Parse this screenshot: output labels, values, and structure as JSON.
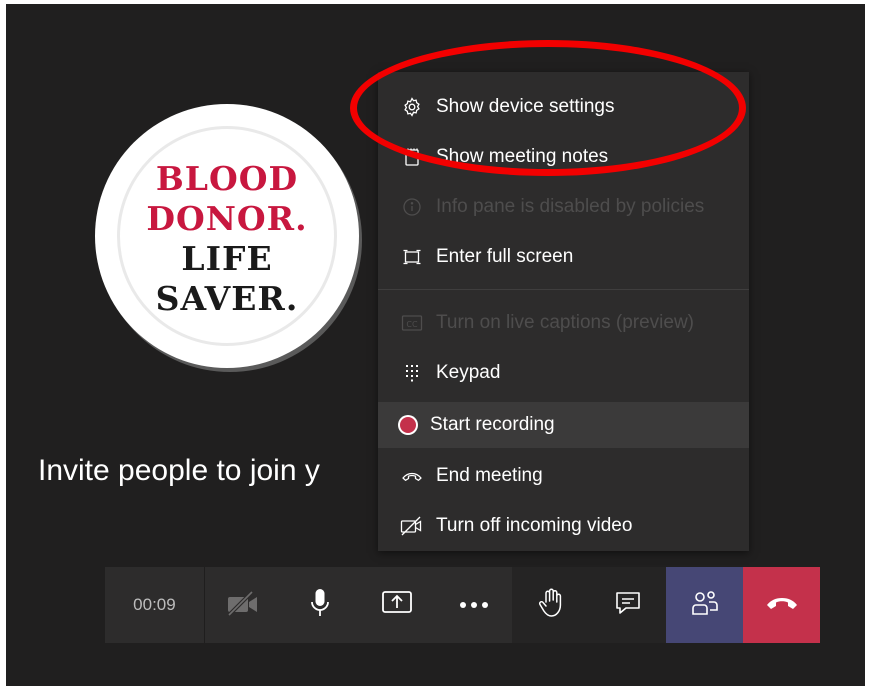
{
  "avatar": {
    "line1": "BLOOD",
    "line2": "DONOR.",
    "line3": "LIFE",
    "line4": "SAVER."
  },
  "invite_text": "Invite people to join y",
  "menu": {
    "items": [
      {
        "label": "Show device settings",
        "icon": "gear-icon",
        "enabled": true
      },
      {
        "label": "Show meeting notes",
        "icon": "notes-icon",
        "enabled": true
      },
      {
        "label": "Info pane is disabled by policies",
        "icon": "info-icon",
        "enabled": false
      },
      {
        "label": "Enter full screen",
        "icon": "fullscreen-icon",
        "enabled": true
      },
      {
        "label": "Turn on live captions (preview)",
        "icon": "captions-icon",
        "enabled": false
      },
      {
        "label": "Keypad",
        "icon": "keypad-icon",
        "enabled": true
      },
      {
        "label": "Start recording",
        "icon": "record-icon",
        "enabled": true
      },
      {
        "label": "End meeting",
        "icon": "end-meeting-icon",
        "enabled": true
      },
      {
        "label": "Turn off incoming video",
        "icon": "video-off-icon",
        "enabled": true
      }
    ]
  },
  "toolbar": {
    "timer": "00:09",
    "buttons": [
      "camera-off-icon",
      "microphone-icon",
      "share-screen-icon",
      "more-options-icon",
      "raise-hand-icon",
      "chat-icon",
      "participants-icon",
      "hang-up-icon"
    ]
  },
  "colors": {
    "stage_bg": "#201f1f",
    "menu_bg": "#2d2c2c",
    "annotation": "#f20000",
    "record": "#c4314b",
    "participants_bg": "#464775",
    "hangup_bg": "#c4314b",
    "avatar_red": "#c8173f"
  }
}
